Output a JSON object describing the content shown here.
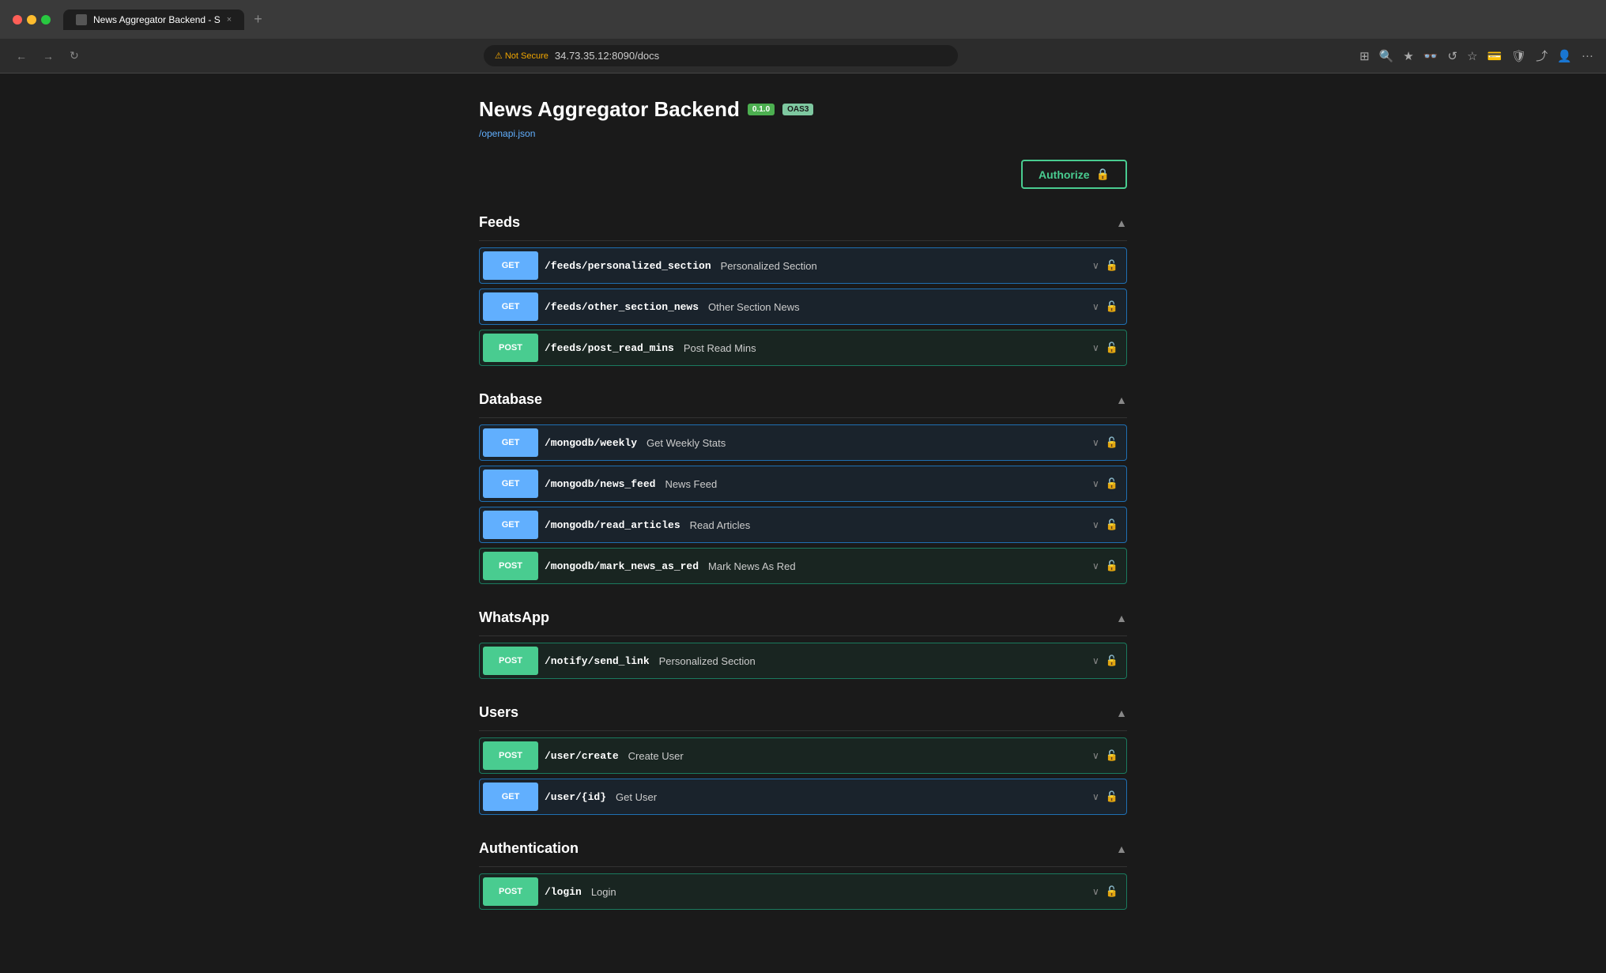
{
  "browser": {
    "tab_label": "News Aggregator Backend - S",
    "tab_close": "×",
    "tab_new": "+",
    "address_warning": "⚠ Not Secure",
    "address_url": "34.73.35.12:8090/docs",
    "nav_back": "←",
    "nav_forward": "→",
    "nav_refresh": "↻"
  },
  "api": {
    "title": "News Aggregator Backend",
    "version_badge": "0.1.0",
    "oas_badge": "OAS3",
    "openapi_link": "/openapi.json",
    "authorize_label": "Authorize",
    "lock_icon": "🔒"
  },
  "sections": [
    {
      "id": "feeds",
      "title": "Feeds",
      "endpoints": [
        {
          "method": "GET",
          "path": "/feeds/personalized_section",
          "desc": "Personalized Section"
        },
        {
          "method": "GET",
          "path": "/feeds/other_section_news",
          "desc": "Other Section News"
        },
        {
          "method": "POST",
          "path": "/feeds/post_read_mins",
          "desc": "Post Read Mins"
        }
      ]
    },
    {
      "id": "database",
      "title": "Database",
      "endpoints": [
        {
          "method": "GET",
          "path": "/mongodb/weekly",
          "desc": "Get Weekly Stats"
        },
        {
          "method": "GET",
          "path": "/mongodb/news_feed",
          "desc": "News Feed"
        },
        {
          "method": "GET",
          "path": "/mongodb/read_articles",
          "desc": "Read Articles"
        },
        {
          "method": "POST",
          "path": "/mongodb/mark_news_as_red",
          "desc": "Mark News As Red"
        }
      ]
    },
    {
      "id": "whatsapp",
      "title": "WhatsApp",
      "endpoints": [
        {
          "method": "POST",
          "path": "/notify/send_link",
          "desc": "Personalized Section"
        }
      ]
    },
    {
      "id": "users",
      "title": "Users",
      "endpoints": [
        {
          "method": "POST",
          "path": "/user/create",
          "desc": "Create User"
        },
        {
          "method": "GET",
          "path": "/user/{id}",
          "desc": "Get User"
        }
      ]
    },
    {
      "id": "authentication",
      "title": "Authentication",
      "endpoints": [
        {
          "method": "POST",
          "path": "/login",
          "desc": "Login"
        }
      ]
    }
  ]
}
